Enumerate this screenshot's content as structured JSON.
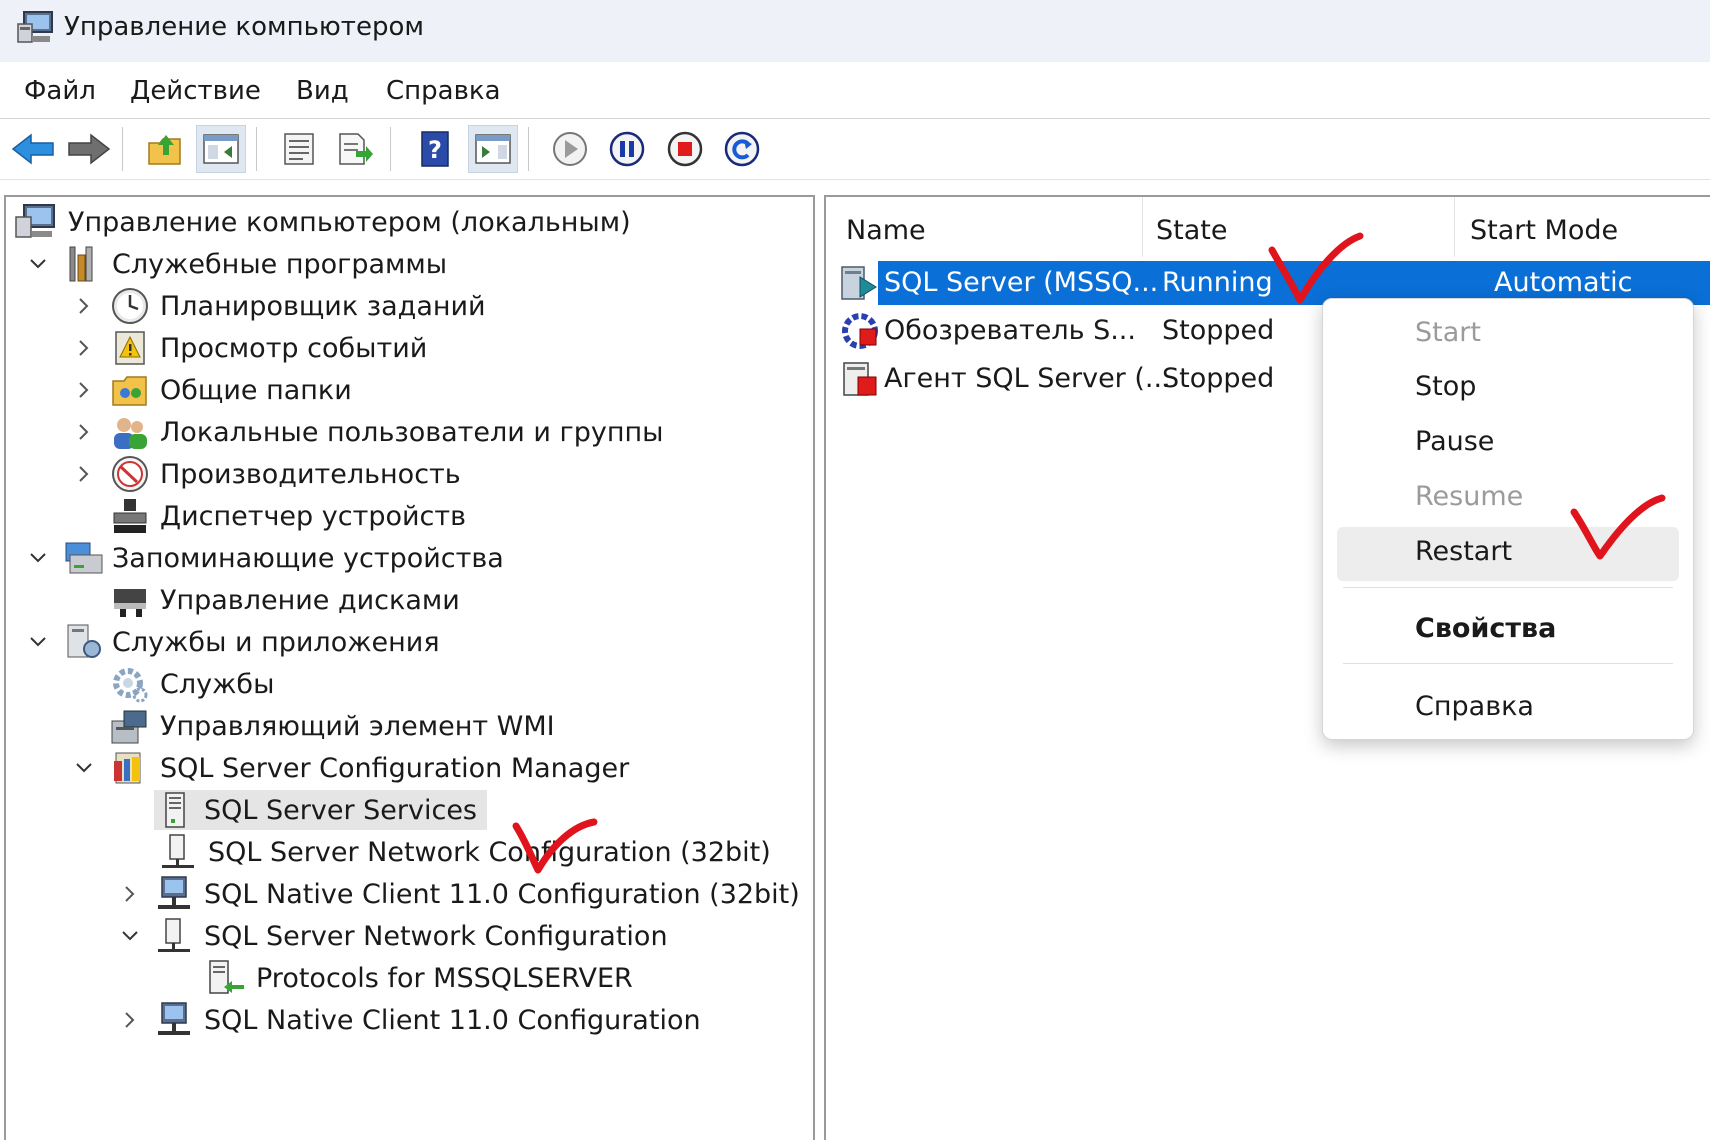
{
  "window": {
    "title": "Управление компьютером"
  },
  "menubar": {
    "items": [
      "Файл",
      "Действие",
      "Вид",
      "Справка"
    ]
  },
  "toolbar": {
    "buttons": [
      "back-arrow-icon",
      "forward-arrow-icon",
      "up-folder-icon",
      "show-hide-tree-icon",
      "properties-icon",
      "export-list-icon",
      "help-icon",
      "action-pane-icon",
      "start-service-icon",
      "pause-service-icon",
      "stop-service-icon",
      "restart-service-icon"
    ]
  },
  "tree": {
    "root": "Управление компьютером (локальным)",
    "system_tools": "Служебные программы",
    "task_scheduler": "Планировщик заданий",
    "event_viewer": "Просмотр событий",
    "shared_folders": "Общие папки",
    "local_users": "Локальные пользователи и группы",
    "performance": "Производительность",
    "device_manager": "Диспетчер устройств",
    "storage": "Запоминающие устройства",
    "disk_management": "Управление дисками",
    "services_apps": "Службы и приложения",
    "services": "Службы",
    "wmi": "Управляющий элемент WMI",
    "sql_config_manager": "SQL Server Configuration Manager",
    "sql_services": "SQL Server Services",
    "sql_net_config_32": "SQL Server Network Configuration (32bit)",
    "native_client_32": "SQL Native Client 11.0 Configuration (32bit)",
    "sql_net_config": "SQL Server Network Configuration",
    "protocols": "Protocols for MSSQLSERVER",
    "native_client": "SQL Native Client 11.0 Configuration"
  },
  "list": {
    "columns": [
      "Name",
      "State",
      "Start Mode"
    ],
    "rows": [
      {
        "name": "SQL Server (MSSQ...",
        "state": "Running",
        "start_mode": "Automatic"
      },
      {
        "name": "Обозреватель S...",
        "state": "Stopped",
        "start_mode": ""
      },
      {
        "name": "Агент SQL Server (...",
        "state": "Stopped",
        "start_mode": ""
      }
    ]
  },
  "context_menu": {
    "start": "Start",
    "stop": "Stop",
    "pause": "Pause",
    "resume": "Resume",
    "restart": "Restart",
    "properties": "Свойства",
    "help": "Справка"
  },
  "colors": {
    "selection": "#0a6fd6",
    "annotation": "#e0141c"
  }
}
